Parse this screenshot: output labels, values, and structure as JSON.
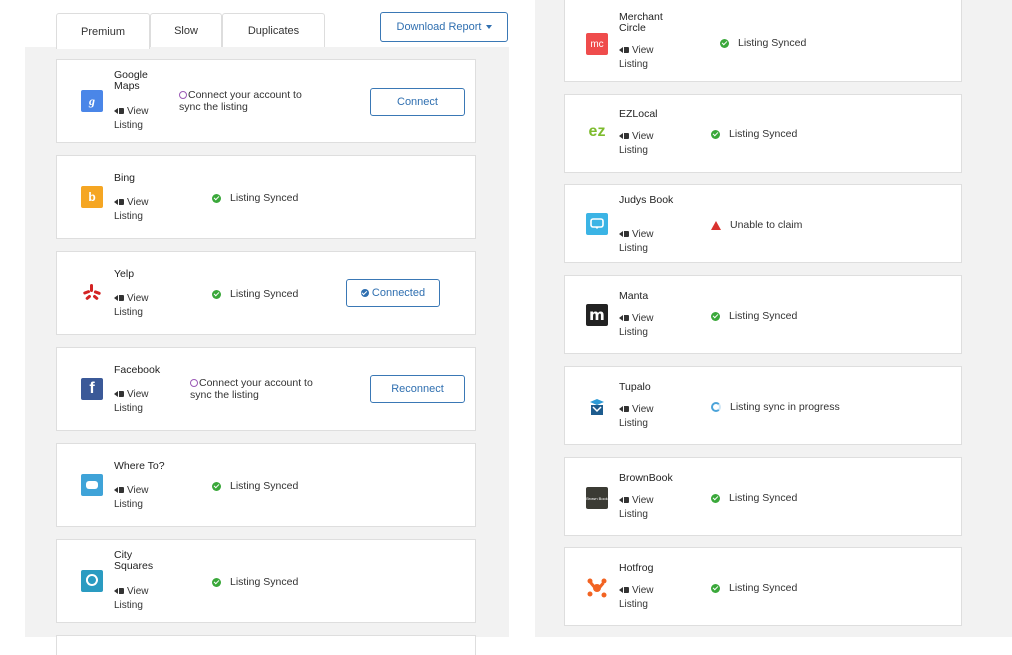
{
  "tabs": [
    {
      "label": "Premium",
      "active": true
    },
    {
      "label": "Slow",
      "active": false
    },
    {
      "label": "Duplicates",
      "active": false
    }
  ],
  "download_label": "Download Report",
  "view_listing_label": "View Listing",
  "connect_message": "Connect your account to sync the listing",
  "left_listings": [
    {
      "name": "Google Maps",
      "logo": "google-maps-logo",
      "status": "",
      "button": "Connect",
      "connect_msg": true
    },
    {
      "name": "Bing",
      "logo": "bing-logo",
      "status": "Listing Synced",
      "button": "",
      "connect_msg": false
    },
    {
      "name": "Yelp",
      "logo": "yelp-logo",
      "status": "Listing Synced",
      "button": "Connected",
      "connect_msg": false
    },
    {
      "name": "Facebook",
      "logo": "facebook-logo",
      "status": "",
      "button": "Reconnect",
      "connect_msg": true
    },
    {
      "name": "Where To?",
      "logo": "where-to-logo",
      "status": "Listing Synced",
      "button": "",
      "connect_msg": false
    },
    {
      "name": "City Squares",
      "logo": "city-squares-logo",
      "status": "Listing Synced",
      "button": "",
      "connect_msg": false
    }
  ],
  "right_listings": [
    {
      "name": "Merchant Circle",
      "logo": "merchant-circle-logo",
      "status": "Listing Synced",
      "status_type": "synced"
    },
    {
      "name": "EZLocal",
      "logo": "ezlocal-logo",
      "status": "Listing Synced",
      "status_type": "synced"
    },
    {
      "name": "Judys Book",
      "logo": "judys-book-logo",
      "status": "Unable to claim",
      "status_type": "error"
    },
    {
      "name": "Manta",
      "logo": "manta-logo",
      "status": "Listing Synced",
      "status_type": "synced"
    },
    {
      "name": "Tupalo",
      "logo": "tupalo-logo",
      "status": "Listing sync in progress",
      "status_type": "progress"
    },
    {
      "name": "BrownBook",
      "logo": "brownbook-logo",
      "status": "Listing Synced",
      "status_type": "synced"
    },
    {
      "name": "Hotfrog",
      "logo": "hotfrog-logo",
      "status": "Listing Synced",
      "status_type": "synced"
    }
  ],
  "logo_text": {
    "merchant_circle": "mc",
    "ezlocal": "ez",
    "manta": "m",
    "brownbook": "Brown Book"
  },
  "colors": {
    "accent": "#2f6fb0",
    "success": "#3aa83a",
    "error": "#d9322e",
    "progress": "#4ba3d9",
    "panel_bg": "#f2f2f2"
  }
}
